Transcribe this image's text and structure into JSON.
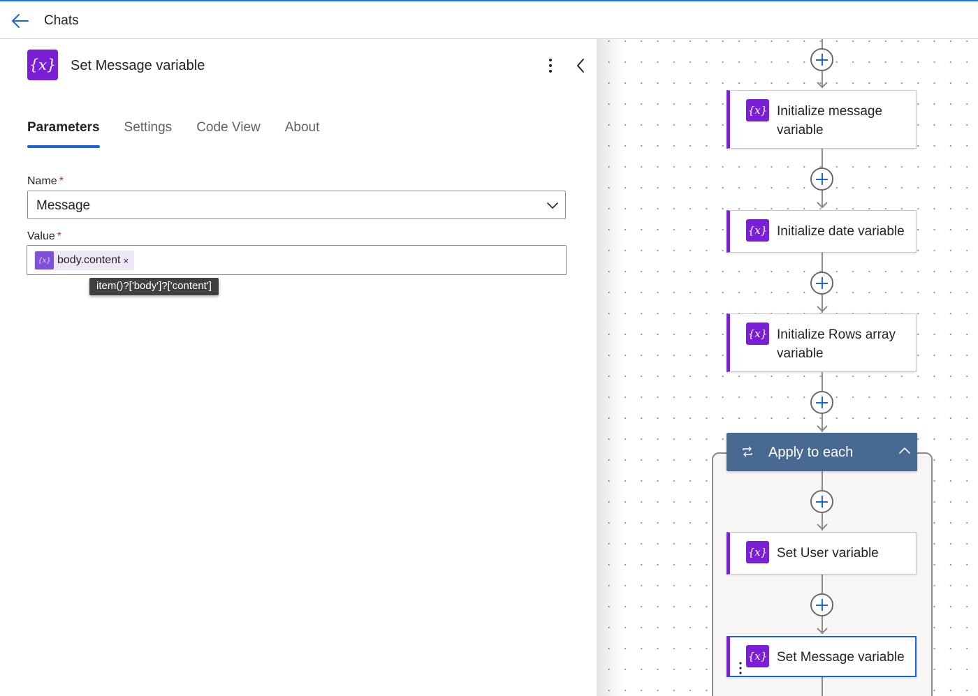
{
  "topbar": {
    "title": "Chats",
    "back_icon": "arrow-left-icon"
  },
  "panel": {
    "title": "Set Message variable",
    "icon_glyph": "{x}",
    "tabs": [
      {
        "label": "Parameters",
        "active": true
      },
      {
        "label": "Settings",
        "active": false
      },
      {
        "label": "Code View",
        "active": false
      },
      {
        "label": "About",
        "active": false
      }
    ],
    "name_field": {
      "label": "Name",
      "required_mark": "*",
      "value": "Message"
    },
    "value_field": {
      "label": "Value",
      "required_mark": "*",
      "token": {
        "icon_glyph": "{x}",
        "text": "body.content",
        "remove": "×"
      },
      "tooltip": "item()?['body']?['content']"
    }
  },
  "canvas": {
    "icon_glyph": "{x}",
    "cards": [
      {
        "text": "Initialize message variable"
      },
      {
        "text": "Initialize date variable"
      },
      {
        "text": "Initialize Rows array variable"
      },
      {
        "text": "Set User variable"
      },
      {
        "text": "Set Message variable",
        "selected": true
      }
    ],
    "loop": {
      "title": "Apply to each"
    }
  },
  "colors": {
    "accent": "#1a66d6",
    "variable_icon": "#7b1fd6",
    "loop_header": "#486991",
    "required": "#c4314b"
  }
}
